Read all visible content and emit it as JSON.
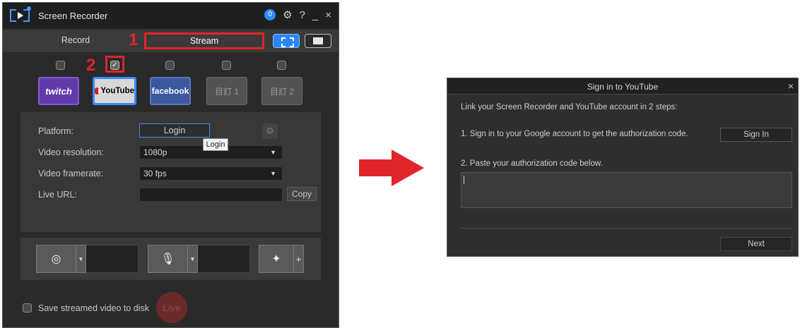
{
  "recorder": {
    "app_title": "Screen Recorder",
    "title_controls": {
      "notification": "0",
      "help": "?",
      "minimize": "_",
      "close": "×"
    },
    "tabs": {
      "record": "Record",
      "stream": "Stream"
    },
    "annotations": {
      "step1": "1",
      "step2": "2"
    },
    "platforms": [
      {
        "label": "twitch",
        "checked": false,
        "selected": false
      },
      {
        "label": "YouTube",
        "checked": true,
        "selected": true
      },
      {
        "label": "facebook",
        "checked": false,
        "selected": false
      },
      {
        "label": "目訂 1",
        "checked": false,
        "selected": false
      },
      {
        "label": "目訂 2",
        "checked": false,
        "selected": false
      }
    ],
    "settings": {
      "platform_label": "Platform:",
      "login_button": "Login",
      "login_tooltip": "Login",
      "resolution_label": "Video resolution:",
      "resolution_value": "1080p",
      "framerate_label": "Video framerate:",
      "framerate_value": "30 fps",
      "live_url_label": "Live URL:",
      "live_url_value": "",
      "copy_button": "Copy"
    },
    "devices": {
      "plus": "+"
    },
    "save_label": "Save streamed video to disk",
    "save_checked": false,
    "live_button": "Live"
  },
  "dialog": {
    "title": "Sign in to YouTube",
    "close": "×",
    "intro": "Link your Screen Recorder and YouTube account in 2 steps:",
    "step1": "1. Sign in to your Google account to get the authorization code.",
    "signin_button": "Sign In",
    "step2": "2. Paste your authorization code below.",
    "code_value": "",
    "next_button": "Next"
  },
  "colors": {
    "accent_blue": "#3b8bff",
    "annotation_red": "#e0262a",
    "twitch_purple": "#5f3aa8",
    "facebook_blue": "#3b579d",
    "youtube_red": "#e21b1b"
  }
}
